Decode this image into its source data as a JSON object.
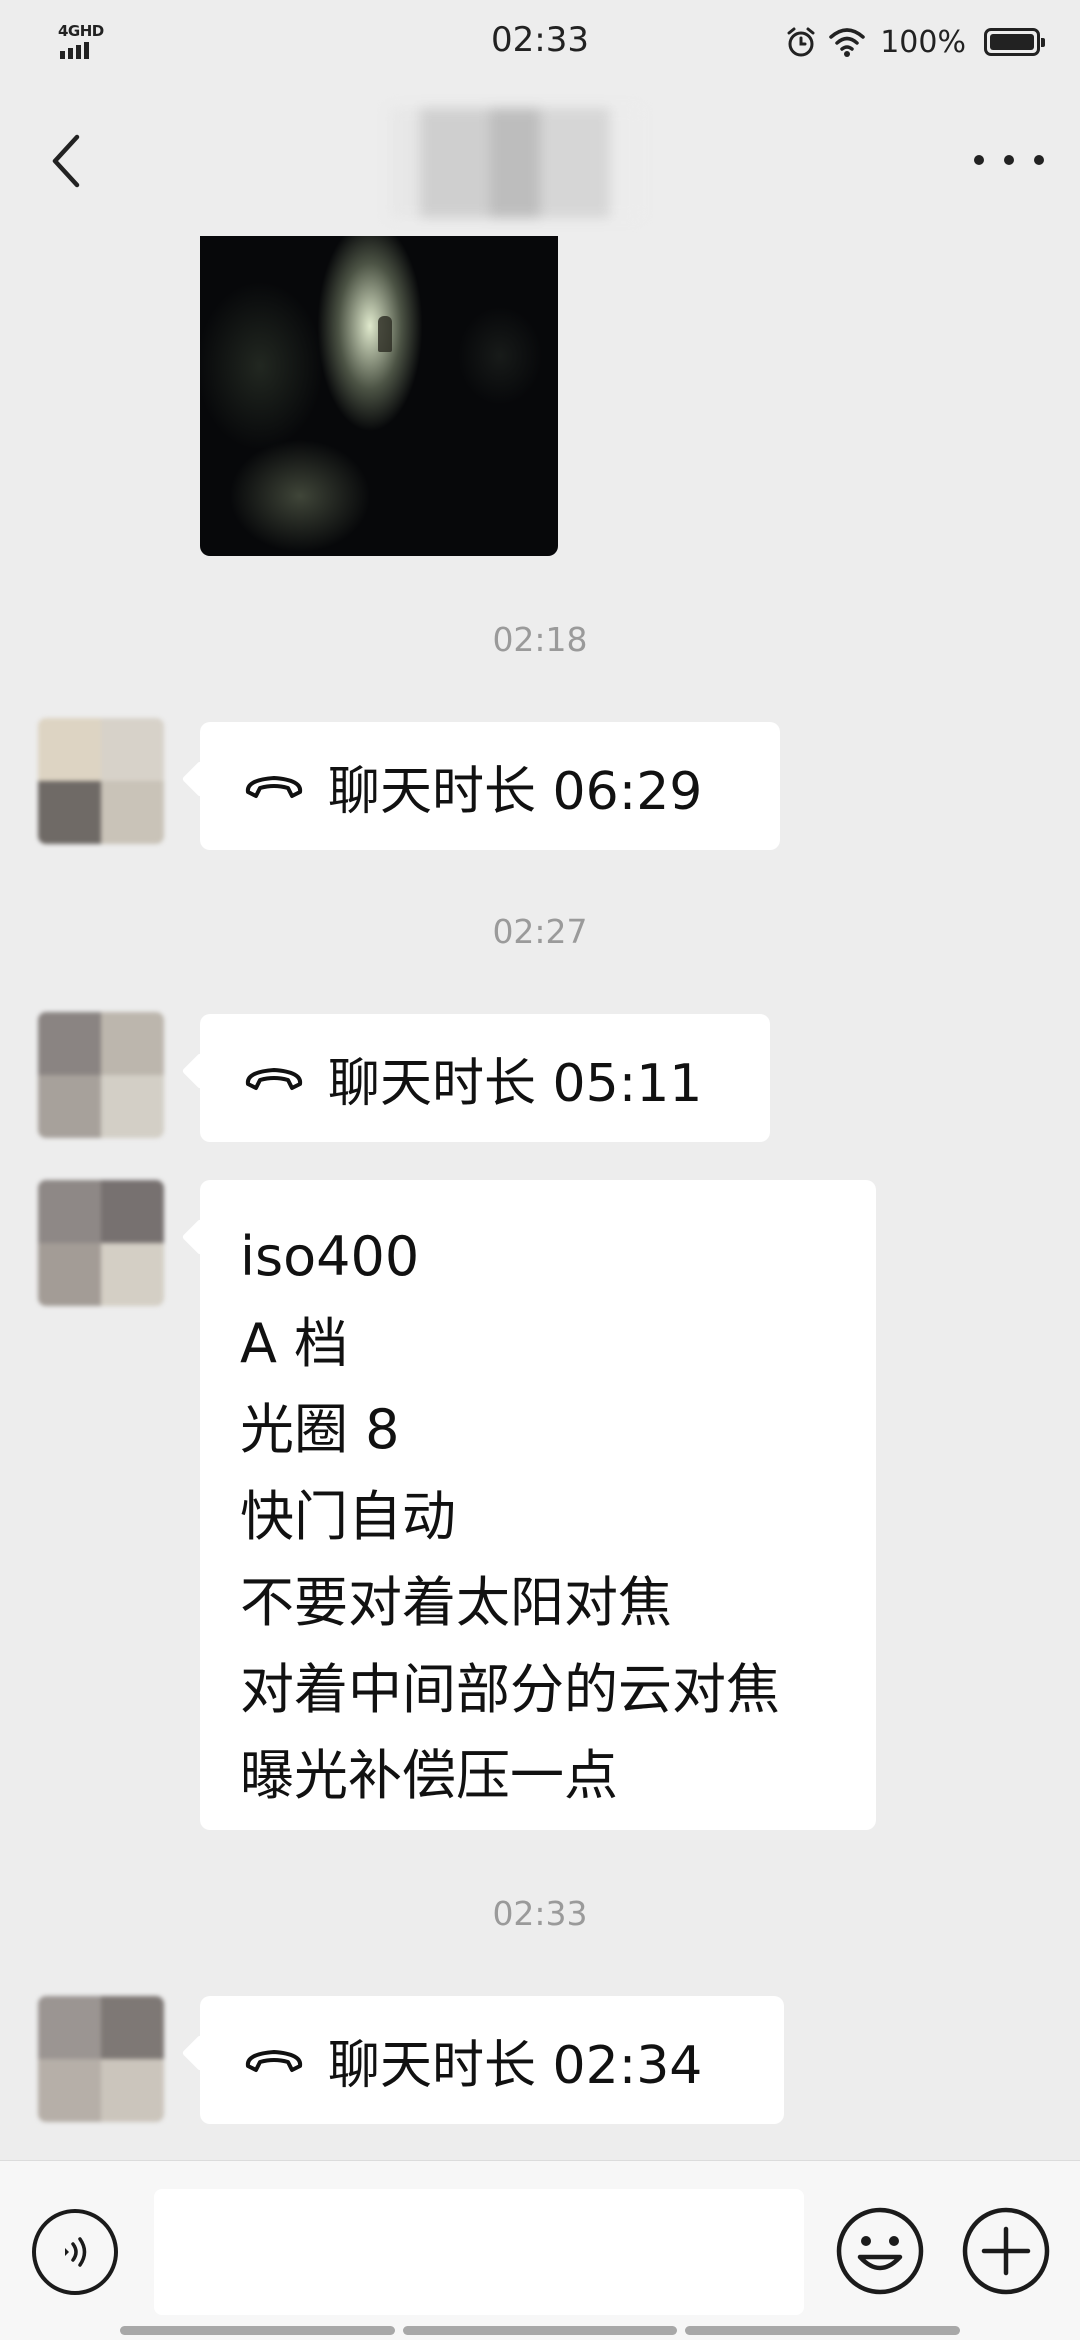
{
  "status_bar": {
    "network": "4GHD",
    "time": "02:33",
    "battery": "100%",
    "icons": [
      "alarm-icon",
      "wifi-icon",
      "battery-icon"
    ]
  },
  "nav": {
    "back_icon": "chevron-left-icon",
    "more_icon": "more-dots-icon"
  },
  "messages": {
    "ts1": "02:18",
    "call1": "聊天时长 06:29",
    "ts2": "02:27",
    "call2": "聊天时长 05:11",
    "text_lines": [
      "iso400",
      "A 档",
      "光圈 8",
      "快门自动",
      "不要对着太阳对焦",
      "对着中间部分的云对焦",
      "曝光补偿压一点"
    ],
    "ts3": "02:33",
    "call3": "聊天时长 02:34"
  },
  "input_bar": {
    "voice_icon": "voice-icon",
    "emoji_icon": "emoji-icon",
    "plus_icon": "plus-icon",
    "input_value": ""
  },
  "colors": {
    "background": "#ededed",
    "bubble": "#ffffff",
    "timestamp": "#9a9a9a",
    "text": "#111111"
  }
}
